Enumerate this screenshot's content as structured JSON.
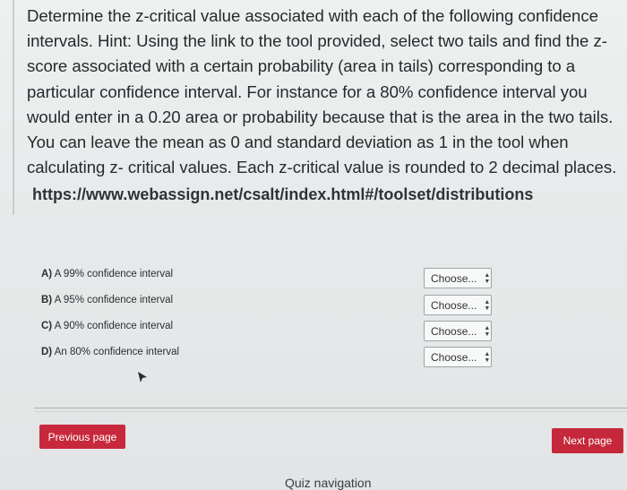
{
  "question": {
    "text": "Determine the z-critical value associated with each of the following confidence intervals. Hint: Using the link to the tool provided, select two tails and find the z-score associated with a certain probability (area in tails) corresponding to a particular confidence interval. For instance for a 80% confidence interval you would enter in a 0.20 area or probability because that is the  area in the two tails.  You can leave the mean as 0 and standard deviation as 1 in the tool when calculating z- critical values. Each z-critical value is rounded to 2 decimal places.",
    "link": "https://www.webassign.net/csalt/index.html#/toolset/distributions"
  },
  "subquestions": [
    {
      "letter": "A)",
      "label": "A 99% confidence interval",
      "selected": "Choose..."
    },
    {
      "letter": "B)",
      "label": "A 95% confidence interval",
      "selected": "Choose..."
    },
    {
      "letter": "C)",
      "label": "A 90% confidence interval",
      "selected": "Choose..."
    },
    {
      "letter": "D)",
      "label": "An 80% confidence interval",
      "selected": "Choose..."
    }
  ],
  "navigation": {
    "previous_label": "Previous page",
    "next_label": "Next page",
    "quiz_nav_label": "Quiz navigation"
  },
  "colors": {
    "button_bg": "#c8283c",
    "text": "#262a2c"
  },
  "icons": {
    "select_arrows": "sort-arrows-icon",
    "cursor": "mouse-pointer-icon"
  }
}
